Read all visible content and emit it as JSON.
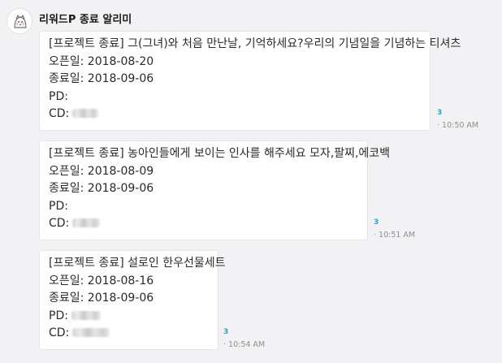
{
  "sender": {
    "name": "리워드P 종료 알리미"
  },
  "messages": [
    {
      "lines": [
        "[프로젝트 종료] 그(그녀)와 처음 만난날, 기억하세요?우리의 기념일을 기념하는 티셔츠",
        "오픈일: 2018-08-20",
        "종료일: 2018-09-06",
        "PD:",
        "CD:"
      ],
      "read_count": "3",
      "time": "· 10:50 AM"
    },
    {
      "lines": [
        "[프로젝트 종료] 농아인들에게 보이는 인사를 해주세요 모자,팔찌,에코백",
        "오픈일: 2018-08-09",
        "종료일: 2018-09-06",
        "PD:",
        "CD:"
      ],
      "read_count": "3",
      "time": "· 10:51 AM"
    },
    {
      "lines": [
        "[프로젝트 종료] 설로인 한우선물세트",
        "오픈일: 2018-08-16",
        "종료일: 2018-09-06",
        "PD:",
        "CD:"
      ],
      "read_count": "3",
      "time": "· 10:54 AM"
    }
  ],
  "icons": {
    "avatar": "bot-avatar-icon"
  },
  "colors": {
    "background": "#f2f2f4",
    "bubble": "#ffffff",
    "read_count": "#2b9fcf",
    "timestamp": "#8f8f8f"
  }
}
